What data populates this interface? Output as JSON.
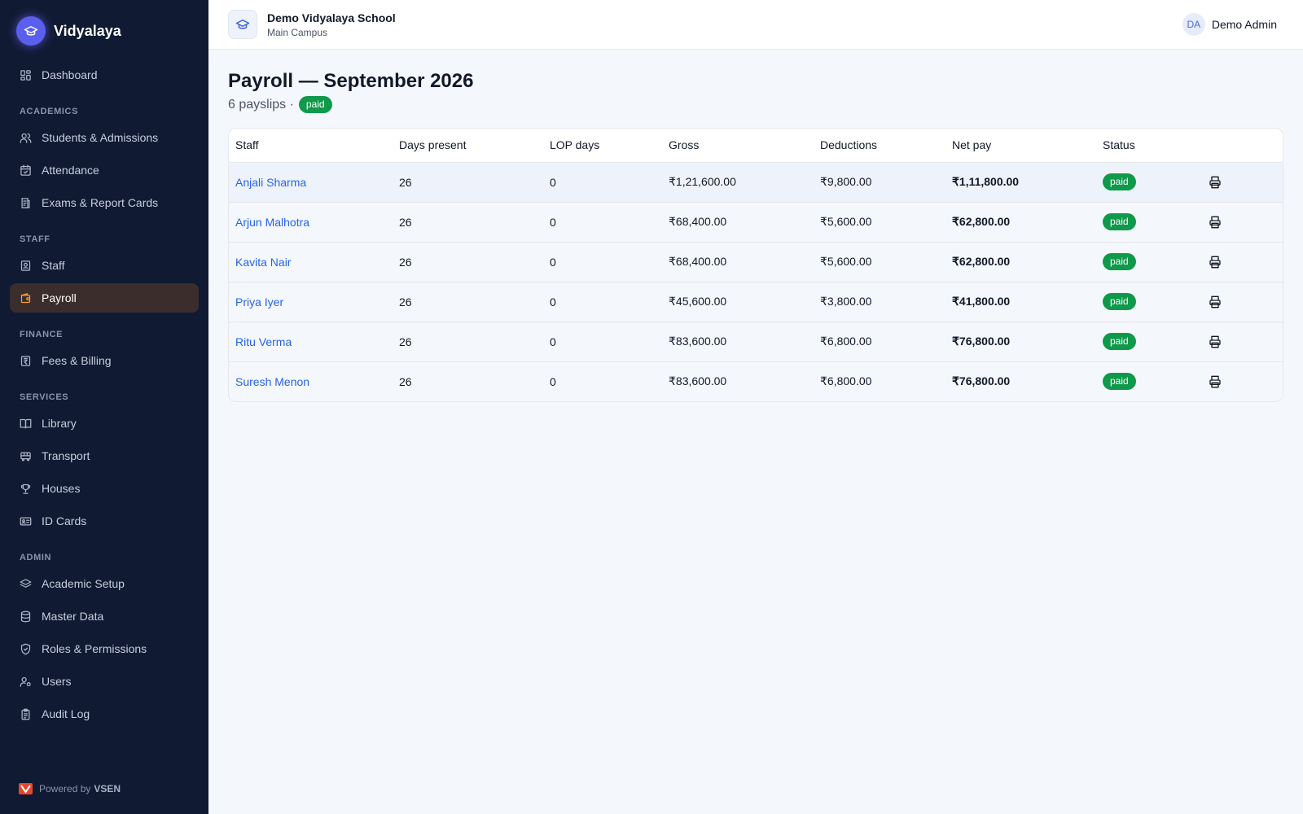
{
  "app": {
    "name": "Vidyalaya",
    "logo_icon": "graduation-cap-icon",
    "accent": "#5b5ff0"
  },
  "sidebar": {
    "dashboard": "Dashboard",
    "sections": {
      "academics": "ACADEMICS",
      "staff": "STAFF",
      "finance": "FINANCE",
      "services": "SERVICES",
      "admin": "ADMIN"
    },
    "items": {
      "students": "Students & Admissions",
      "attendance": "Attendance",
      "exams": "Exams & Report Cards",
      "staff": "Staff",
      "payroll": "Payroll",
      "fees": "Fees & Billing",
      "library": "Library",
      "transport": "Transport",
      "houses": "Houses",
      "id_cards": "ID Cards",
      "academic_setup": "Academic Setup",
      "master_data": "Master Data",
      "roles": "Roles & Permissions",
      "users": "Users",
      "audit_log": "Audit Log"
    },
    "active": "Payroll",
    "active_color": "#f59e3b",
    "powered_by": "Powered by",
    "powered_brand": "VSEN"
  },
  "header": {
    "school_name": "Demo Vidyalaya School",
    "campus": "Main Campus",
    "user_initials": "DA",
    "user_name": "Demo Admin"
  },
  "page": {
    "title": "Payroll — September 2026",
    "count_text": "6 payslips ·",
    "status_badge": "paid",
    "status_color": "#0f9a4b"
  },
  "table": {
    "columns": {
      "staff": "Staff",
      "days_present": "Days present",
      "lop_days": "LOP days",
      "gross": "Gross",
      "deductions": "Deductions",
      "net_pay": "Net pay",
      "status": "Status"
    },
    "rows": [
      {
        "staff": "Anjali Sharma",
        "days": "26",
        "lop": "0",
        "gross": "₹1,21,600.00",
        "deductions": "₹9,800.00",
        "net": "₹1,11,800.00",
        "status": "paid"
      },
      {
        "staff": "Arjun Malhotra",
        "days": "26",
        "lop": "0",
        "gross": "₹68,400.00",
        "deductions": "₹5,600.00",
        "net": "₹62,800.00",
        "status": "paid"
      },
      {
        "staff": "Kavita Nair",
        "days": "26",
        "lop": "0",
        "gross": "₹68,400.00",
        "deductions": "₹5,600.00",
        "net": "₹62,800.00",
        "status": "paid"
      },
      {
        "staff": "Priya Iyer",
        "days": "26",
        "lop": "0",
        "gross": "₹45,600.00",
        "deductions": "₹3,800.00",
        "net": "₹41,800.00",
        "status": "paid"
      },
      {
        "staff": "Ritu Verma",
        "days": "26",
        "lop": "0",
        "gross": "₹83,600.00",
        "deductions": "₹6,800.00",
        "net": "₹76,800.00",
        "status": "paid"
      },
      {
        "staff": "Suresh Menon",
        "days": "26",
        "lop": "0",
        "gross": "₹83,600.00",
        "deductions": "₹6,800.00",
        "net": "₹76,800.00",
        "status": "paid"
      }
    ],
    "row_action_icon": "printer-icon"
  }
}
